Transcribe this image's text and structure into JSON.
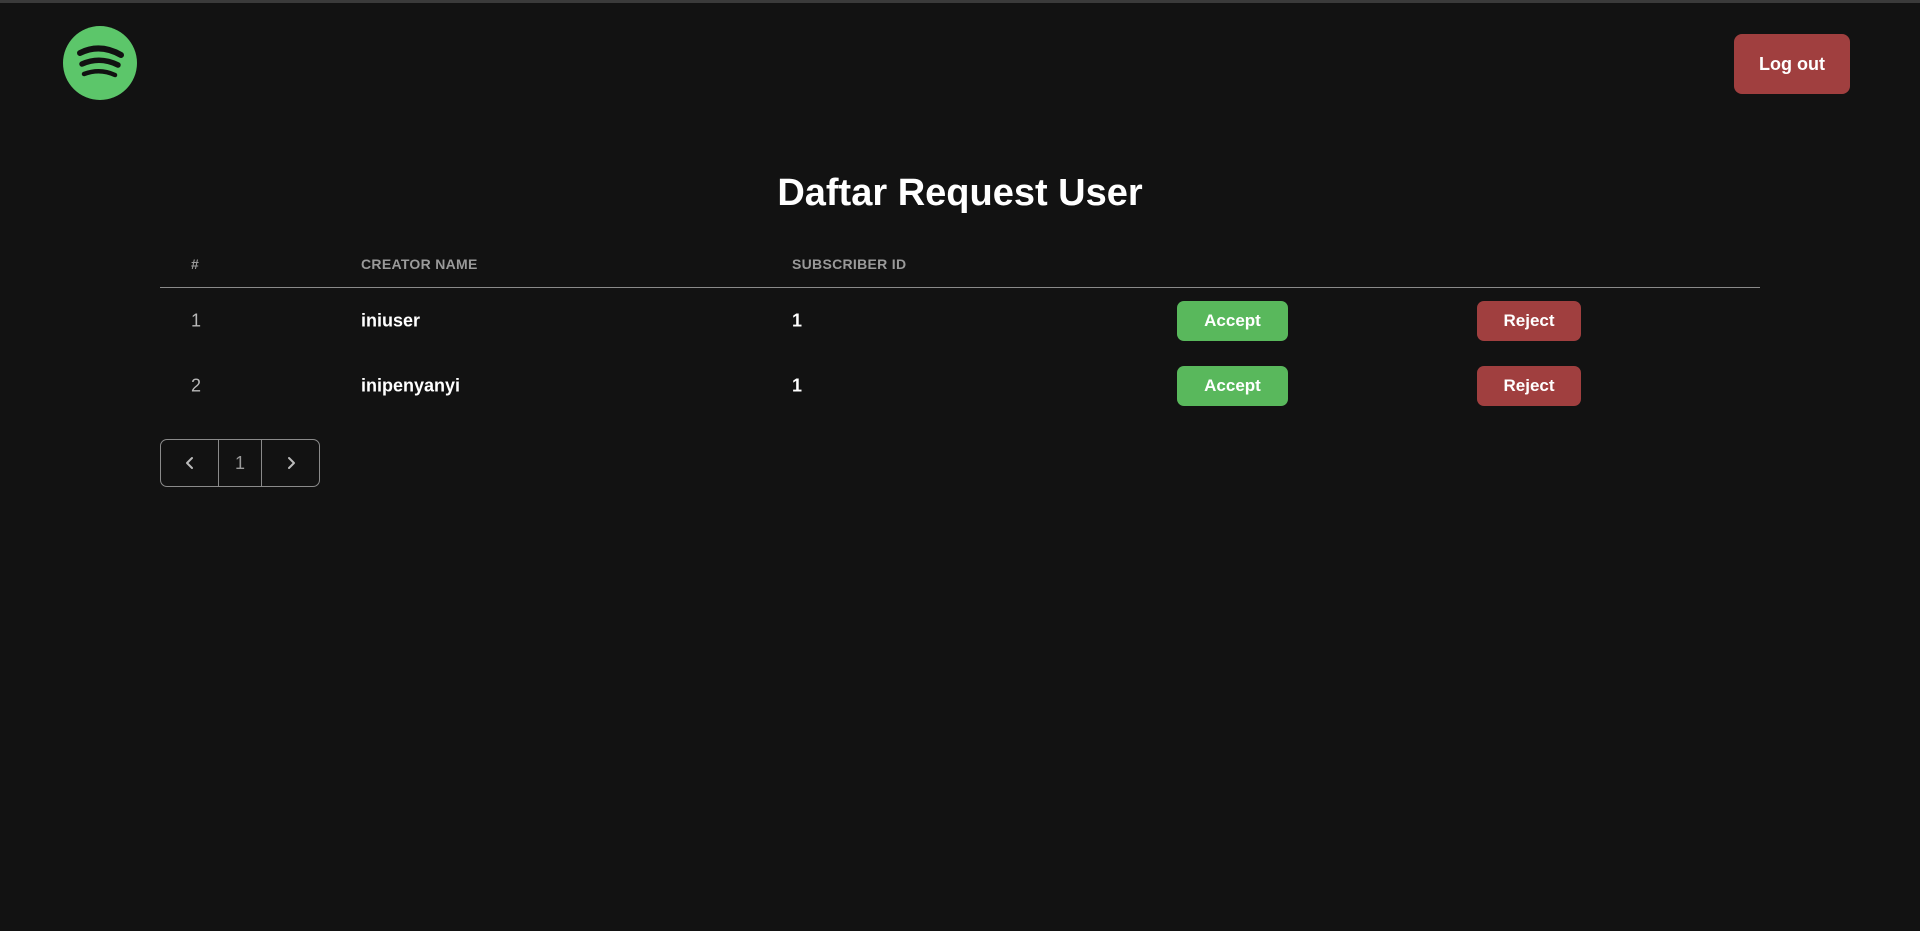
{
  "header": {
    "logo_icon": "spotify-logo-icon",
    "logout_label": "Log out"
  },
  "page": {
    "title": "Daftar Request User"
  },
  "table": {
    "columns": [
      "#",
      "CREATOR NAME",
      "SUBSCRIBER ID"
    ],
    "rows": [
      {
        "num": "1",
        "creator_name": "iniuser",
        "subscriber_id": "1",
        "accept_label": "Accept",
        "reject_label": "Reject"
      },
      {
        "num": "2",
        "creator_name": "inipenyanyi",
        "subscriber_id": "1",
        "accept_label": "Accept",
        "reject_label": "Reject"
      }
    ]
  },
  "pagination": {
    "prev_icon": "chevron-left-icon",
    "current_page": "1",
    "next_icon": "chevron-right-icon"
  },
  "colors": {
    "background": "#121212",
    "brand_green": "#5cc66a",
    "accept_green": "#59b85c",
    "danger_red": "#a03f3f"
  }
}
